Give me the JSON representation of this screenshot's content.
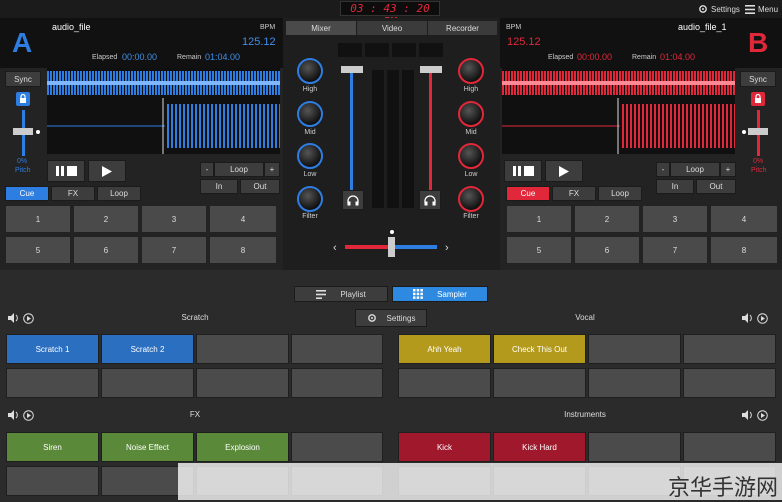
{
  "topbar": {
    "clock": "03 : 43 : 20 PM",
    "settings": "Settings",
    "menu": "Menu"
  },
  "deckA": {
    "letter": "A",
    "file": "audio_file",
    "bpm_label": "BPM",
    "bpm": "125.12",
    "elapsed_label": "Elapsed",
    "elapsed": "00:00.00",
    "remain_label": "Remain",
    "remain": "01:04.00",
    "sync": "Sync",
    "pitch_value": "0%",
    "pitch_label": "Pitch",
    "loop_minus": "-",
    "loop": "Loop",
    "loop_plus": "+",
    "in": "In",
    "out": "Out",
    "tabs": [
      "Cue",
      "FX",
      "Loop"
    ],
    "pads": [
      "1",
      "2",
      "3",
      "4",
      "5",
      "6",
      "7",
      "8"
    ],
    "color": "#2e7de0"
  },
  "deckB": {
    "letter": "B",
    "file": "audio_file_1",
    "bpm_label": "BPM",
    "bpm": "125.12",
    "elapsed_label": "Elapsed",
    "elapsed": "00:00.00",
    "remain_label": "Remain",
    "remain": "01:04.00",
    "sync": "Sync",
    "pitch_value": "0%",
    "pitch_label": "Pitch",
    "loop_minus": "-",
    "loop": "Loop",
    "loop_plus": "+",
    "in": "In",
    "out": "Out",
    "tabs": [
      "Cue",
      "FX",
      "Loop"
    ],
    "pads": [
      "1",
      "2",
      "3",
      "4",
      "5",
      "6",
      "7",
      "8"
    ],
    "color": "#e0283a"
  },
  "mixer": {
    "tabs": [
      "Mixer",
      "Video",
      "Recorder"
    ],
    "knobs": [
      "High",
      "Mid",
      "Low",
      "Filter"
    ]
  },
  "lower": {
    "playlist": "Playlist",
    "sampler": "Sampler",
    "settings": "Settings",
    "sections": {
      "scratch": {
        "title": "Scratch",
        "pads": [
          "Scratch 1",
          "Scratch 2",
          "",
          "",
          "",
          "",
          "",
          ""
        ]
      },
      "vocal": {
        "title": "Vocal",
        "pads": [
          "Ahh Yeah",
          "Check This Out",
          "",
          "",
          "",
          "",
          "",
          ""
        ]
      },
      "fx": {
        "title": "FX",
        "pads": [
          "Siren",
          "Noise Effect",
          "Explosion",
          "",
          "",
          "",
          "",
          ""
        ]
      },
      "instruments": {
        "title": "Instruments",
        "pads": [
          "Kick",
          "Kick Hard",
          "",
          "",
          "",
          "",
          "",
          ""
        ]
      }
    }
  },
  "watermark": "京华手游网"
}
